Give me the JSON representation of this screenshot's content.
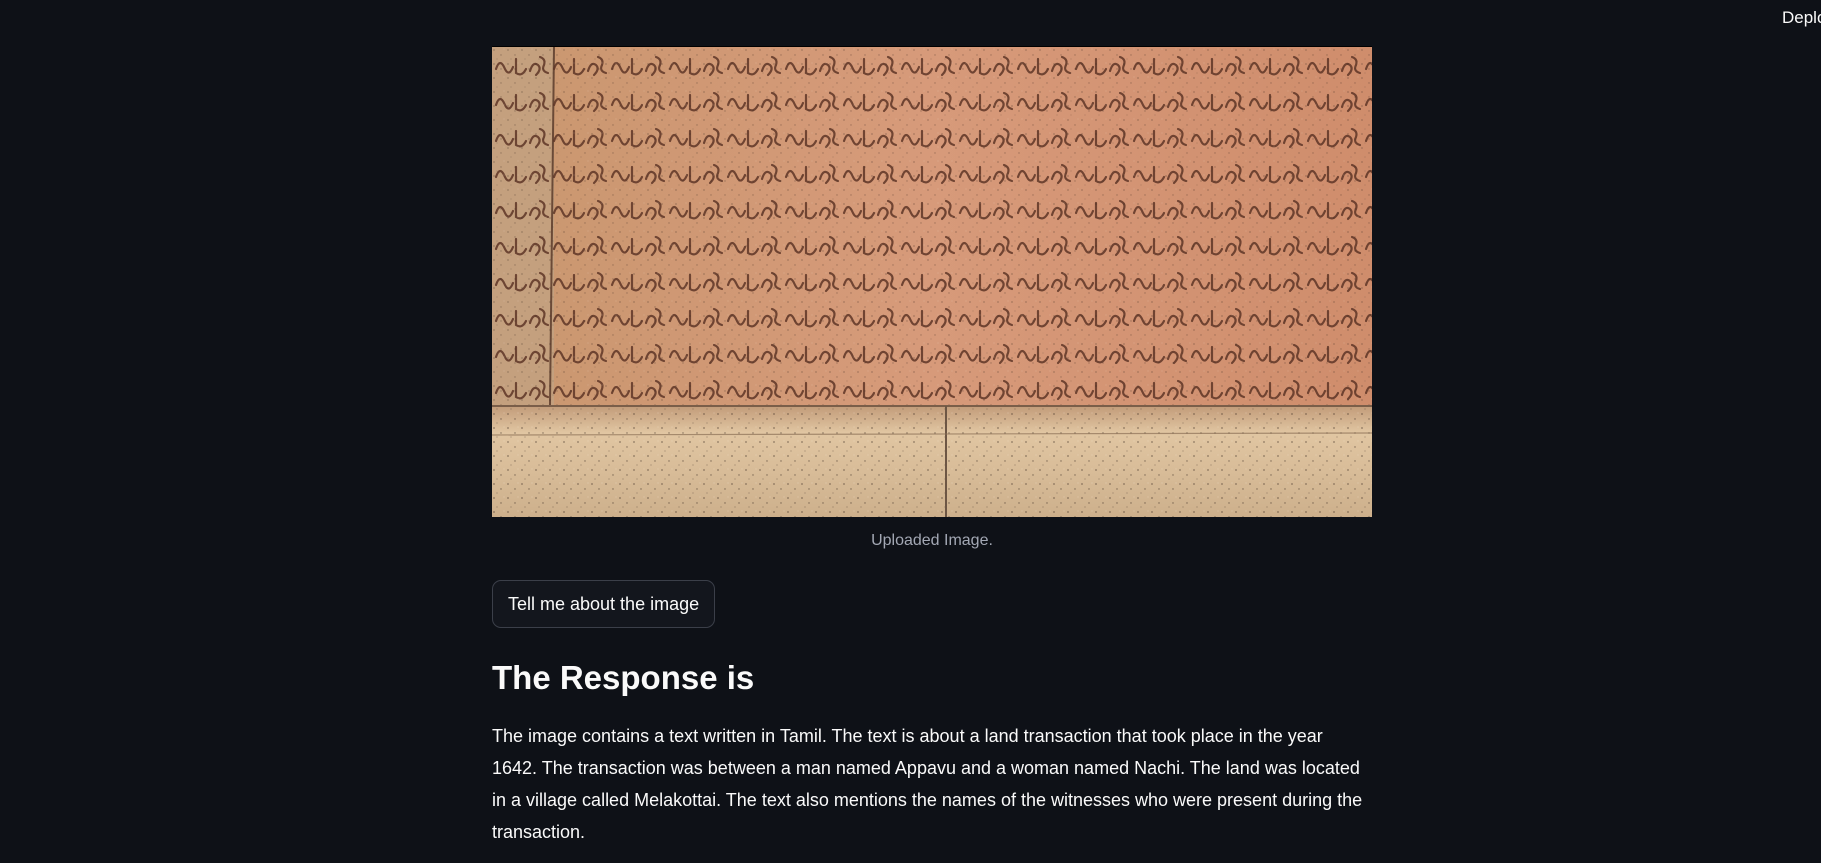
{
  "header": {
    "deploy_label": "Deploy"
  },
  "image": {
    "caption": "Uploaded Image."
  },
  "actions": {
    "describe_button": "Tell me about the image"
  },
  "response": {
    "heading": "The Response is",
    "text": "The image contains a text written in Tamil. The text is about a land transaction that took place in the year 1642. The transaction was between a man named Appavu and a woman named Nachi. The land was located in a village called Melakottai. The text also mentions the names of the witnesses who were present during the transaction."
  },
  "colors": {
    "background": "#0e1117",
    "stone": "#c98f6e",
    "stone_light": "#e3c29d",
    "carving": "#5a3323"
  }
}
